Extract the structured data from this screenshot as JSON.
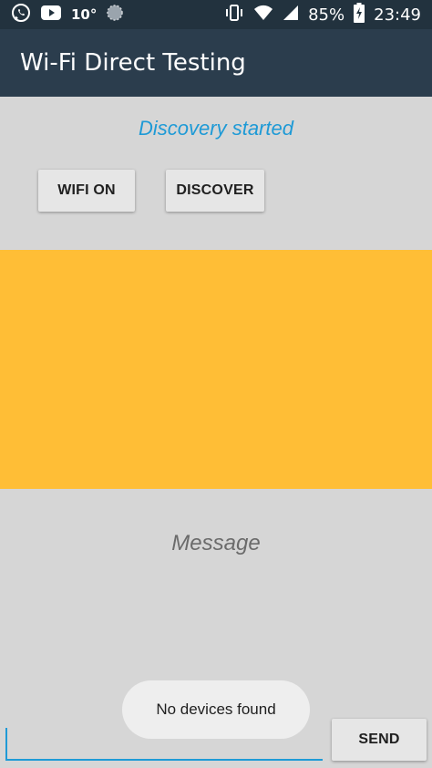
{
  "status_bar": {
    "temperature": "10°",
    "battery_percent": "85%",
    "time": "23:49",
    "icons_left": [
      "whatsapp-icon",
      "youtube-icon",
      "weather-icon"
    ],
    "icons_right": [
      "vibrate-icon",
      "wifi-icon",
      "signal-icon",
      "battery-charging-icon"
    ]
  },
  "app_bar": {
    "title": "Wi-Fi Direct Testing"
  },
  "main": {
    "status_text": "Discovery started",
    "wifi_button_label": "WIFI ON",
    "discover_button_label": "DISCOVER",
    "message_text": "Message",
    "send_button_label": "SEND",
    "input_value": ""
  },
  "toast": {
    "text": "No devices found"
  },
  "colors": {
    "status_bar": "#22323e",
    "app_bar": "#2b3d4d",
    "background": "#d6d6d6",
    "device_list": "#ffbe36",
    "accent": "#1e9ad6"
  }
}
